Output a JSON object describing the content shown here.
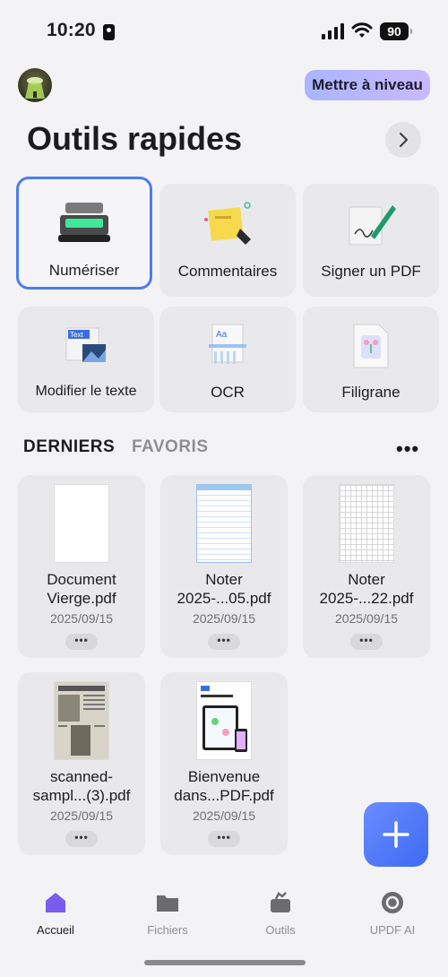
{
  "status": {
    "time": "10:20",
    "battery": "90"
  },
  "header": {
    "upgrade_label": "Mettre à niveau"
  },
  "quick_tools": {
    "title": "Outils rapides",
    "items": [
      {
        "label": "Numériser",
        "icon": "scanner-icon"
      },
      {
        "label": "Commentaires",
        "icon": "sticky-note-icon"
      },
      {
        "label": "Signer un PDF",
        "icon": "signature-pen-icon"
      },
      {
        "label": "Modifier le texte",
        "icon": "edit-text-icon"
      },
      {
        "label": "OCR",
        "icon": "ocr-icon"
      },
      {
        "label": "Filigrane",
        "icon": "watermark-icon"
      }
    ]
  },
  "files_tabs": {
    "recent": "DERNIERS",
    "favorites": "FAVORIS"
  },
  "files": [
    {
      "name_line1": "Document",
      "name_line2": "Vierge.pdf",
      "date": "2025/09/15"
    },
    {
      "name_line1": "Noter",
      "name_line2": "2025-...05.pdf",
      "date": "2025/09/15"
    },
    {
      "name_line1": "Noter",
      "name_line2": "2025-...22.pdf",
      "date": "2025/09/15"
    },
    {
      "name_line1": "scanned-",
      "name_line2": "sampl...(3).pdf",
      "date": "2025/09/15"
    },
    {
      "name_line1": "Bienvenue",
      "name_line2": "dans...PDF.pdf",
      "date": "2025/09/15"
    }
  ],
  "nav": {
    "home": "Accueil",
    "files": "Fichiers",
    "tools": "Outils",
    "ai": "UPDF AI"
  },
  "colors": {
    "accent": "#4c7df0",
    "upgrade_start": "#a9b6ff",
    "upgrade_end": "#c9b8ff",
    "fab": "#3d6bf2"
  }
}
